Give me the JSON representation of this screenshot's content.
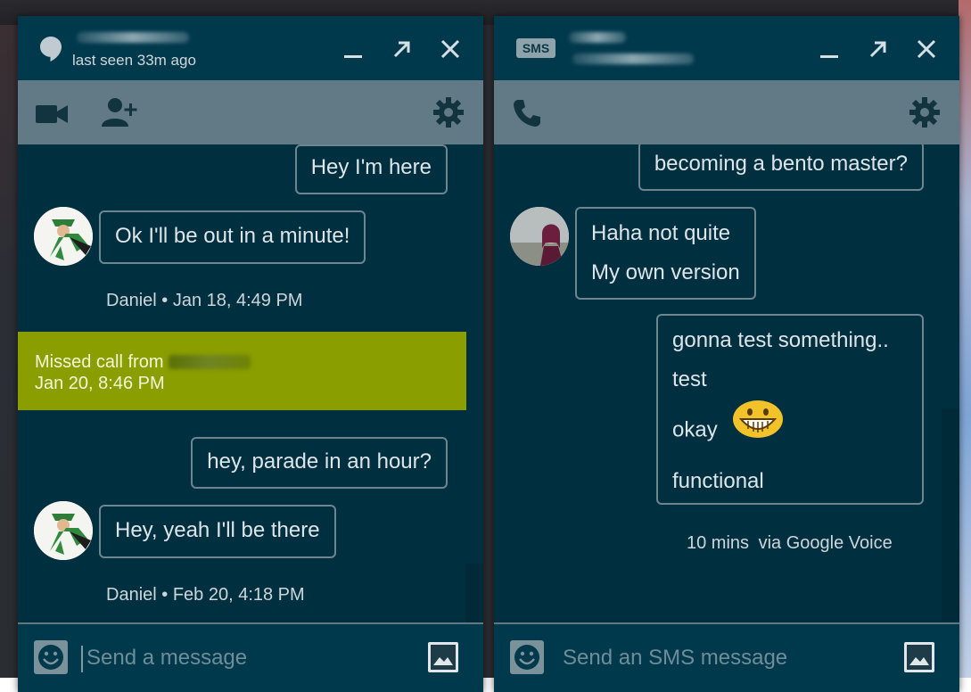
{
  "left_chat": {
    "status": "last seen 33m ago",
    "messages": [
      {
        "type": "outgoing",
        "text": "Hey I'm here"
      },
      {
        "type": "incoming",
        "text": "Ok I'll be out in a minute!",
        "meta": "Daniel • Jan 18, 4:49 PM"
      },
      {
        "type": "missed_call",
        "label": "Missed call from",
        "time": "Jan 20, 8:46 PM"
      },
      {
        "type": "outgoing",
        "text": "hey, parade in an hour?"
      },
      {
        "type": "incoming",
        "text": "Hey, yeah I'll be there",
        "meta": "Daniel • Feb 20, 4:18 PM"
      }
    ],
    "composer_placeholder": "Send a message"
  },
  "right_chat": {
    "badge": "SMS",
    "messages": [
      {
        "type": "outgoing",
        "text": "becoming a bento master?"
      },
      {
        "type": "incoming",
        "lines": [
          "Haha not quite",
          "My own version"
        ]
      },
      {
        "type": "outgoing",
        "lines": [
          "gonna test something..",
          "test",
          "okay",
          "functional"
        ]
      }
    ],
    "meta_time": "10 mins",
    "meta_via": "via Google Voice",
    "composer_placeholder": "Send an SMS message"
  },
  "colors": {
    "panel_bg": "#002f3f",
    "titlebar_bg": "#00394c",
    "toolbar_bg": "#627a86",
    "missed_call_bg": "#8a9e00",
    "bubble_border": "#6d858f"
  },
  "icons": [
    "hangouts-icon",
    "minimize-icon",
    "popout-icon",
    "close-icon",
    "video-call-icon",
    "add-person-icon",
    "gear-icon",
    "phone-icon",
    "emoji-icon",
    "image-icon",
    "grinning-emoji-icon"
  ]
}
